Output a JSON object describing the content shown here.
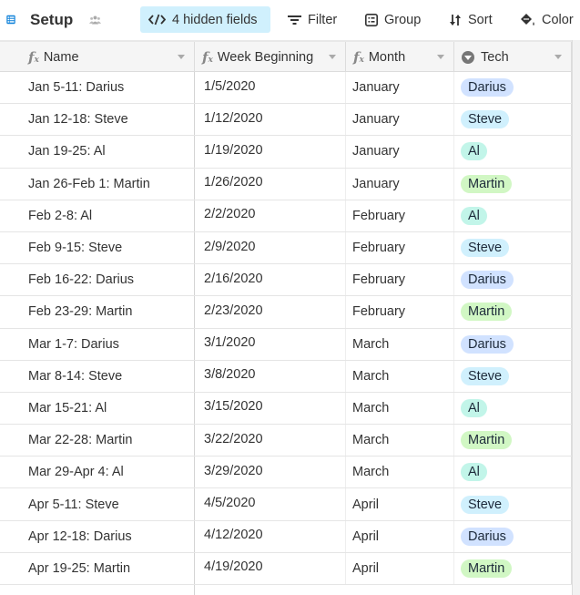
{
  "toolbar": {
    "view_name": "Setup",
    "hidden_fields_label": "4 hidden fields",
    "filter_label": "Filter",
    "group_label": "Group",
    "sort_label": "Sort",
    "color_label": "Color"
  },
  "columns": [
    {
      "label": "Name",
      "type": "formula"
    },
    {
      "label": "Week Beginning",
      "type": "formula"
    },
    {
      "label": "Month",
      "type": "formula"
    },
    {
      "label": "Tech",
      "type": "single-select"
    }
  ],
  "tech_colors": {
    "Darius": "#d1e2ff",
    "Steve": "#d0f0fd",
    "Al": "#c2f5e9",
    "Martin": "#d1f7c4"
  },
  "rows": [
    {
      "name": "Jan 5-11: Darius",
      "week": "1/5/2020",
      "month": "January",
      "tech": "Darius"
    },
    {
      "name": "Jan 12-18: Steve",
      "week": "1/12/2020",
      "month": "January",
      "tech": "Steve"
    },
    {
      "name": "Jan 19-25: Al",
      "week": "1/19/2020",
      "month": "January",
      "tech": "Al"
    },
    {
      "name": "Jan 26-Feb 1: Martin",
      "week": "1/26/2020",
      "month": "January",
      "tech": "Martin"
    },
    {
      "name": "Feb 2-8: Al",
      "week": "2/2/2020",
      "month": "February",
      "tech": "Al"
    },
    {
      "name": "Feb 9-15: Steve",
      "week": "2/9/2020",
      "month": "February",
      "tech": "Steve"
    },
    {
      "name": "Feb 16-22: Darius",
      "week": "2/16/2020",
      "month": "February",
      "tech": "Darius"
    },
    {
      "name": "Feb 23-29: Martin",
      "week": "2/23/2020",
      "month": "February",
      "tech": "Martin"
    },
    {
      "name": "Mar 1-7: Darius",
      "week": "3/1/2020",
      "month": "March",
      "tech": "Darius"
    },
    {
      "name": "Mar 8-14: Steve",
      "week": "3/8/2020",
      "month": "March",
      "tech": "Steve"
    },
    {
      "name": "Mar 15-21: Al",
      "week": "3/15/2020",
      "month": "March",
      "tech": "Al"
    },
    {
      "name": "Mar 22-28: Martin",
      "week": "3/22/2020",
      "month": "March",
      "tech": "Martin"
    },
    {
      "name": "Mar 29-Apr 4: Al",
      "week": "3/29/2020",
      "month": "March",
      "tech": "Al"
    },
    {
      "name": "Apr 5-11: Steve",
      "week": "4/5/2020",
      "month": "April",
      "tech": "Steve"
    },
    {
      "name": "Apr 12-18: Darius",
      "week": "4/12/2020",
      "month": "April",
      "tech": "Darius"
    },
    {
      "name": "Apr 19-25: Martin",
      "week": "4/19/2020",
      "month": "April",
      "tech": "Martin"
    }
  ]
}
